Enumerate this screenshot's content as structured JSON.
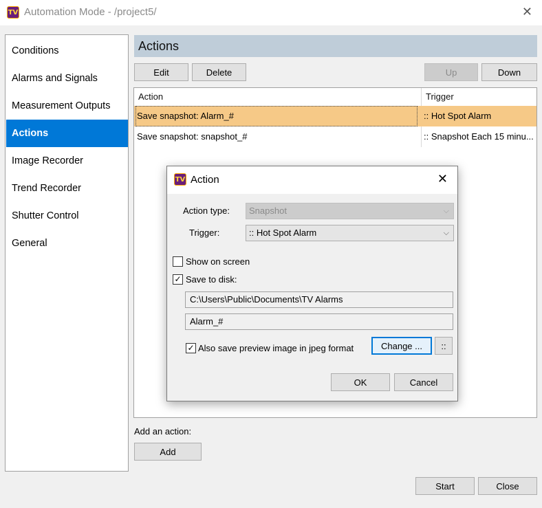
{
  "window": {
    "title": "Automation Mode - /project5/",
    "icon_text": "TV",
    "close_glyph": "✕"
  },
  "sidebar": {
    "items": [
      {
        "label": "Conditions"
      },
      {
        "label": "Alarms and Signals"
      },
      {
        "label": "Measurement Outputs"
      },
      {
        "label": "Actions",
        "active": true
      },
      {
        "label": "Image Recorder"
      },
      {
        "label": "Trend Recorder"
      },
      {
        "label": "Shutter Control"
      },
      {
        "label": "General"
      }
    ]
  },
  "actions_panel": {
    "header": "Actions",
    "edit_label": "Edit",
    "delete_label": "Delete",
    "up_label": "Up",
    "down_label": "Down",
    "columns": [
      "Action",
      "Trigger"
    ],
    "rows": [
      {
        "action": "Save snapshot: Alarm_#",
        "trigger": ":: Hot Spot Alarm",
        "selected": true
      },
      {
        "action": "Save snapshot: snapshot_#",
        "trigger": ":: Snapshot Each 15 minu..."
      }
    ],
    "add_label_text": "Add an action:",
    "add_button": "Add"
  },
  "footer": {
    "start_label": "Start",
    "close_label": "Close"
  },
  "dialog": {
    "title": "Action",
    "icon_text": "TV",
    "close_glyph": "✕",
    "action_type_label": "Action type:",
    "action_type_value": "Snapshot",
    "trigger_label": "Trigger:",
    "trigger_value": ":: Hot Spot Alarm",
    "dropdown_glyph": "⌵",
    "show_on_screen_label": "Show on screen",
    "show_on_screen_checked": false,
    "save_to_disk_label": "Save to disk:",
    "save_to_disk_checked": true,
    "check_glyph": "✓",
    "folder_path": "C:\\Users\\Public\\Documents\\TV Alarms",
    "file_name": "Alarm_#",
    "jpeg_preview_label": "Also save preview image in jpeg format",
    "jpeg_preview_checked": true,
    "change_button": "Change ...",
    "more_button": "::",
    "ok_button": "OK",
    "cancel_button": "Cancel"
  },
  "colors": {
    "accent": "#0078d7",
    "selection": "#f6c987",
    "header_bg": "#bfcdd9"
  }
}
